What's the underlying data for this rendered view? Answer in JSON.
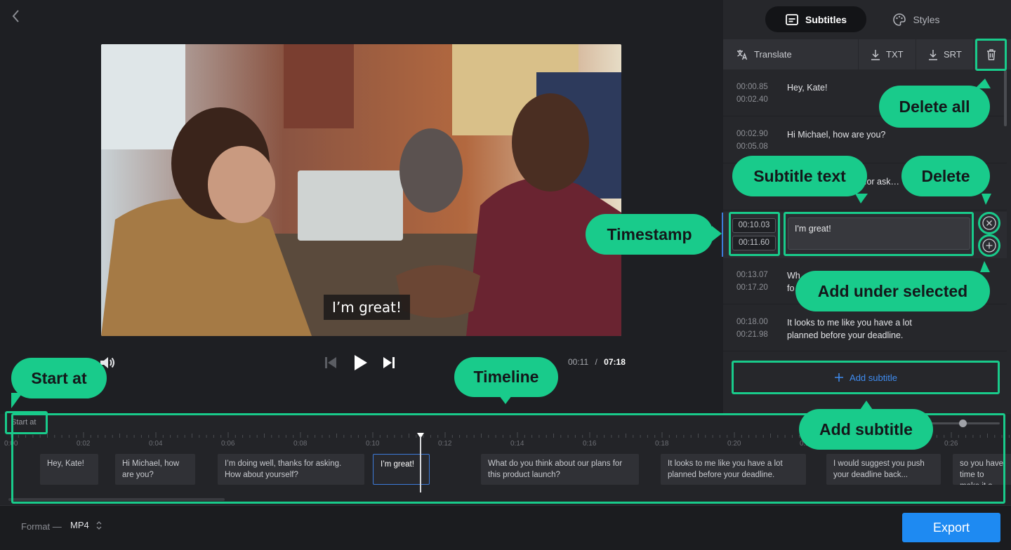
{
  "player": {
    "caption": "I’m great!",
    "current_time": "00:11",
    "separator": "/",
    "total_time": "07:18"
  },
  "tabs": {
    "subtitles": "Subtitles",
    "styles": "Styles"
  },
  "toolbar": {
    "translate": "Translate",
    "txt": "TXT",
    "srt": "SRT"
  },
  "subtitles": [
    {
      "start": "00:00.85",
      "end": "00:02.40",
      "text": "Hey, Kate!"
    },
    {
      "start": "00:02.90",
      "end": "00:05.08",
      "text": "Hi Michael, how are you?"
    },
    {
      "start": "",
      "end": "",
      "text": "ks for ask… ?"
    },
    {
      "start": "00:10.03",
      "end": "00:11.60",
      "text": "I'm great!"
    },
    {
      "start": "00:13.07",
      "end": "00:17.20",
      "text": "Wh… fo…"
    },
    {
      "start": "00:18.00",
      "end": "00:21.98",
      "text": "It looks to me like you have a lot planned before your deadline."
    }
  ],
  "add_subtitle": "Add subtitle",
  "timeline": {
    "start_at": "Start at",
    "ticks": [
      "0:00",
      "0:02",
      "0:04",
      "0:06",
      "0:08",
      "0:10",
      "0:12",
      "0:14",
      "0:16",
      "0:18",
      "0:20",
      "0:22",
      "0:24",
      "0:26"
    ],
    "clips": [
      "Hey, Kate!",
      "Hi Michael, how are you?",
      "I’m doing well, thanks for asking. How about yourself?",
      "I’m great!",
      "What do you think about our plans for this product launch?",
      "It looks to me like you have a lot planned before your deadline.",
      "I would suggest you push your deadline back...",
      "so you have time to make it a successful ad..."
    ]
  },
  "footer": {
    "format_label": "Format —",
    "format_value": "MP4",
    "export": "Export"
  },
  "annotations": {
    "delete_all": "Delete all",
    "subtitle_text": "Subtitle text",
    "delete": "Delete",
    "timestamp": "Timestamp",
    "add_under_selected": "Add under selected",
    "start_at": "Start at",
    "timeline": "Timeline",
    "add_subtitle": "Add subtitle"
  },
  "colors": {
    "annotation": "#19cb8b",
    "accent": "#1e8af2",
    "selection": "#3d7bd9"
  },
  "icons": {
    "back": "chevron-left-icon",
    "subtitles_tab": "subtitles-icon",
    "styles_tab": "palette-icon",
    "translate": "translate-icon",
    "download": "download-icon",
    "trash": "trash-icon",
    "volume": "volume-icon",
    "previous": "skip-back-icon",
    "play": "play-icon",
    "next": "skip-forward-icon",
    "close": "close-circle-icon",
    "add": "plus-circle-icon"
  }
}
